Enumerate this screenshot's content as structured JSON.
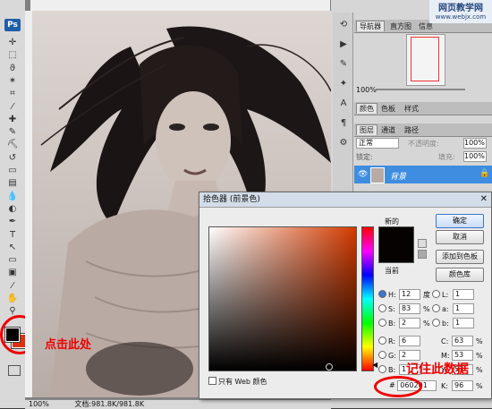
{
  "app": {
    "logo": "Ps"
  },
  "tools": [
    {
      "name": "move-tool",
      "glyph": "✛"
    },
    {
      "name": "marquee-tool",
      "glyph": "⬚"
    },
    {
      "name": "lasso-tool",
      "glyph": "ϑ"
    },
    {
      "name": "magic-wand-tool",
      "glyph": "✶"
    },
    {
      "name": "crop-tool",
      "glyph": "⌗"
    },
    {
      "name": "eyedropper-tool",
      "glyph": "⁄"
    },
    {
      "name": "healing-tool",
      "glyph": "✚"
    },
    {
      "name": "brush-tool",
      "glyph": "✎"
    },
    {
      "name": "stamp-tool",
      "glyph": "⛏"
    },
    {
      "name": "history-brush-tool",
      "glyph": "↺"
    },
    {
      "name": "eraser-tool",
      "glyph": "▭"
    },
    {
      "name": "gradient-tool",
      "glyph": "▤"
    },
    {
      "name": "blur-tool",
      "glyph": "💧"
    },
    {
      "name": "dodge-tool",
      "glyph": "◐"
    },
    {
      "name": "pen-tool",
      "glyph": "✒"
    },
    {
      "name": "type-tool",
      "glyph": "T"
    },
    {
      "name": "path-select-tool",
      "glyph": "↖"
    },
    {
      "name": "shape-tool",
      "glyph": "▭"
    },
    {
      "name": "notes-tool",
      "glyph": "▣"
    },
    {
      "name": "eyedropper2-tool",
      "glyph": "⁄"
    },
    {
      "name": "hand-tool",
      "glyph": "✋"
    },
    {
      "name": "zoom-tool",
      "glyph": "⚲"
    }
  ],
  "colors": {
    "foreground": "#060201",
    "background": "#e03010",
    "annotation": "#e00000"
  },
  "document": {
    "status_zoom": "100%",
    "status_doc": "文档:981.8K/981.8K",
    "annotation_left": "点击此处"
  },
  "navigator_panel": {
    "tabs": [
      "导航器",
      "直方图",
      "信息"
    ],
    "zoom": "100%"
  },
  "watermark": {
    "line1": "网页教学网",
    "line2": "www.webjx.com"
  },
  "color_panel": {
    "tabs": [
      "颜色",
      "色板",
      "样式"
    ]
  },
  "layers_panel": {
    "tabs": [
      "图层",
      "通道",
      "路径"
    ],
    "blend_mode": "正常",
    "opacity_label": "不透明度:",
    "opacity": "100%",
    "lock_label": "锁定:",
    "fill_label": "填充:",
    "fill": "100%",
    "layer_name": "背景"
  },
  "picker": {
    "title": "拾色器 (前景色)",
    "new_label": "新的",
    "current_label": "当前",
    "buttons": {
      "ok": "确定",
      "cancel": "取消",
      "add_swatch": "添加到色板",
      "libraries": "颜色库"
    },
    "hsb": [
      {
        "label": "H:",
        "value": "12",
        "unit": "度",
        "selected": true
      },
      {
        "label": "S:",
        "value": "83",
        "unit": "%",
        "selected": false
      },
      {
        "label": "B:",
        "value": "2",
        "unit": "%",
        "selected": false
      }
    ],
    "rgb": [
      {
        "label": "R:",
        "value": "6"
      },
      {
        "label": "G:",
        "value": "2"
      },
      {
        "label": "B:",
        "value": "1"
      }
    ],
    "lab": [
      {
        "label": "L:",
        "value": "1"
      },
      {
        "label": "a:",
        "value": "1"
      },
      {
        "label": "b:",
        "value": "1"
      }
    ],
    "cmyk": [
      {
        "label": "C:",
        "value": "63",
        "unit": "%"
      },
      {
        "label": "M:",
        "value": "53",
        "unit": "%"
      },
      {
        "label": "Y:",
        "value": "53",
        "unit": "%"
      },
      {
        "label": "K:",
        "value": "96",
        "unit": "%"
      }
    ],
    "hex_label": "#",
    "hex": "060201",
    "web_only": "只有 Web 颜色",
    "annotation": "记住此数据"
  }
}
